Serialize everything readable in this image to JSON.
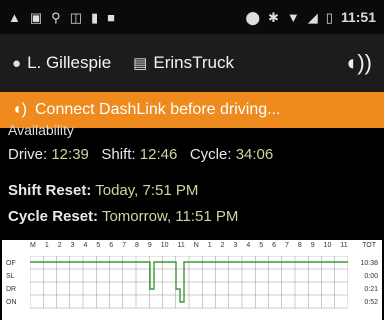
{
  "status_bar": {
    "time": "11:51",
    "left_icons": [
      "warning-icon",
      "image-icon",
      "usb-icon",
      "nfc-icon",
      "battery-saver-icon",
      "square-icon"
    ],
    "right_icons": [
      "location-icon",
      "bluetooth-icon",
      "wifi-icon",
      "signal-icon",
      "battery-icon"
    ]
  },
  "header": {
    "driver_name": "L. Gillespie",
    "truck_name": "ErinsTruck",
    "driver_icon": "person-icon",
    "truck_icon": "truck-icon",
    "dashlink_icon": "dashlink-icon"
  },
  "banner": {
    "text": "Connect DashLink before driving..."
  },
  "availability": {
    "label": "Availability",
    "drive_label": "Drive:",
    "drive_value": "12:39",
    "shift_label": "Shift:",
    "shift_value": "12:46",
    "cycle_label": "Cycle:",
    "cycle_value": "34:06",
    "shift_reset_label": "Shift Reset:",
    "shift_reset_value": "Today, 7:51 PM",
    "cycle_reset_label": "Cycle Reset:",
    "cycle_reset_value": "Tomorrow, 11:51 PM"
  },
  "log_grid": {
    "hours": [
      "M",
      "1",
      "2",
      "3",
      "4",
      "5",
      "6",
      "7",
      "8",
      "9",
      "10",
      "11",
      "N",
      "1",
      "2",
      "3",
      "4",
      "5",
      "6",
      "7",
      "8",
      "9",
      "10",
      "11"
    ],
    "total_header": "TOT",
    "rows": [
      {
        "label": "OF",
        "total": "10:38"
      },
      {
        "label": "SL",
        "total": "0:00"
      },
      {
        "label": "DR",
        "total": "0:21"
      },
      {
        "label": "ON",
        "total": "0:52"
      }
    ],
    "line_color": "#3a9a3a"
  }
}
